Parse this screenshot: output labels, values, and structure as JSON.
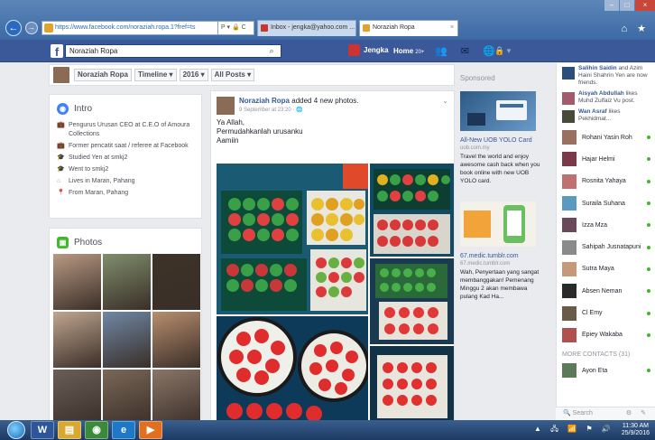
{
  "browser": {
    "url": "https://www.facebook.com/noraziah.ropa.1?fref=ts",
    "url_tools": "P ▾ 🔒 C",
    "tabs": [
      {
        "label": "Inbox - jengka@yahoo.com ...",
        "color": "#c33"
      },
      {
        "label": "Noraziah Ropa",
        "color": "#e3a22c"
      }
    ],
    "back_label": "←",
    "forward_label": "→",
    "close_tab_label": "×",
    "icons_label": "⌂ ★",
    "window_buttons": [
      "–",
      "□",
      "×"
    ]
  },
  "fb": {
    "search_value": "Noraziah Ropa",
    "user_name": "Jengka",
    "home_label": "Home",
    "home_count": "20+",
    "icons_label": "👥 ✉ 🌐",
    "menu_label": "🔒 ▾"
  },
  "timeline_nav": {
    "name": "Noraziah Ropa",
    "timeline": "Timeline ▾",
    "year": "2016 ▾",
    "filter": "All Posts ▾"
  },
  "intro": {
    "title": "Intro",
    "items": [
      {
        "icon": "💼",
        "text": "Pengurus Urusan CEO at C.E.O of Amoura Collections"
      },
      {
        "icon": "💼",
        "text": "Former pencatit saat / referee at Facebook"
      },
      {
        "icon": "🎓",
        "text": "Studied Yen at smkj2"
      },
      {
        "icon": "🎓",
        "text": "Went to smkj2"
      },
      {
        "icon": "⌂",
        "text": "Lives in Maran, Pahang"
      },
      {
        "icon": "📍",
        "text": "From Maran, Pahang"
      }
    ]
  },
  "photos": {
    "title": "Photos",
    "colors": [
      "#b99a83",
      "#7f8e6c",
      "#3d3327",
      "#c0a68f",
      "#6f88a6",
      "#b88e6e",
      "#6a5e58",
      "#7a6858",
      "#8a7668"
    ]
  },
  "post": {
    "author": "Noraziah Ropa",
    "action": "added 4 new photos.",
    "date": "9 September at 23:20 · 🌐",
    "lines": [
      "Ya Allah,",
      "Permudahkanlah urusanku",
      "Aamiin"
    ]
  },
  "sponsored": {
    "label": "Sponsored",
    "ads": [
      {
        "title": "All-New UOB YOLO Card",
        "sub": "uob.com.my",
        "text": "Travel the world and enjoy awesome cash back when you book online with new UOB YOLO card.",
        "color": "#3c6fa0"
      },
      {
        "title": "67.medic.tumblr.com",
        "sub": "67.medic.tumblr.com",
        "text": "Wah, Penyertaan yang sangat membanggakan! Pemenang Minggu 2 akan membawa pulang Kad Ha...",
        "color": "#f2a33a"
      }
    ]
  },
  "ticker": [
    {
      "name": "Salihin Saidin",
      "text": "and Azim Haini Shahrin Yen are now friends.",
      "color": "#2b4f7a"
    },
    {
      "name": "Aisyah Abdullah",
      "text": "likes Muhd Zulfaiz Vu post.",
      "color": "#a35a6a"
    },
    {
      "name": "Wan Asraf",
      "text": "likes Pekhidmat...",
      "color": "#4a4a3a"
    }
  ],
  "contacts": [
    {
      "name": "Rohani Yasin Roh",
      "color": "#9a7060"
    },
    {
      "name": "Hajar Helmi",
      "color": "#7a3a4a"
    },
    {
      "name": "Rosnita Yahaya",
      "color": "#c07070"
    },
    {
      "name": "Suraila Suhana",
      "color": "#5a9ac0"
    },
    {
      "name": "Izza Mza",
      "color": "#6a4a5a"
    },
    {
      "name": "Sahipah Jusnatapuni",
      "color": "#8a8a8a"
    },
    {
      "name": "Sutra Maya",
      "color": "#c49a7a"
    },
    {
      "name": "Absen Neman",
      "color": "#2a2a2a"
    },
    {
      "name": "Cl Emy",
      "color": "#6a5a4a"
    },
    {
      "name": "Epiey Wakaba",
      "color": "#b05050"
    }
  ],
  "more_contacts_label": "MORE CONTACTS (31)",
  "more_contacts": [
    {
      "name": "Ayon Eta",
      "color": "#5a7a5a"
    }
  ],
  "chat_search": "🔍 Search",
  "chat_search_icons": "⚙ ✎",
  "taskbar": {
    "apps": [
      "W",
      "▤",
      "◉",
      "e",
      "▶"
    ],
    "tray_icons": "▲ 🖧 📶 ⚑ 🔊",
    "time": "11:30 AM",
    "date": "25/9/2016"
  }
}
